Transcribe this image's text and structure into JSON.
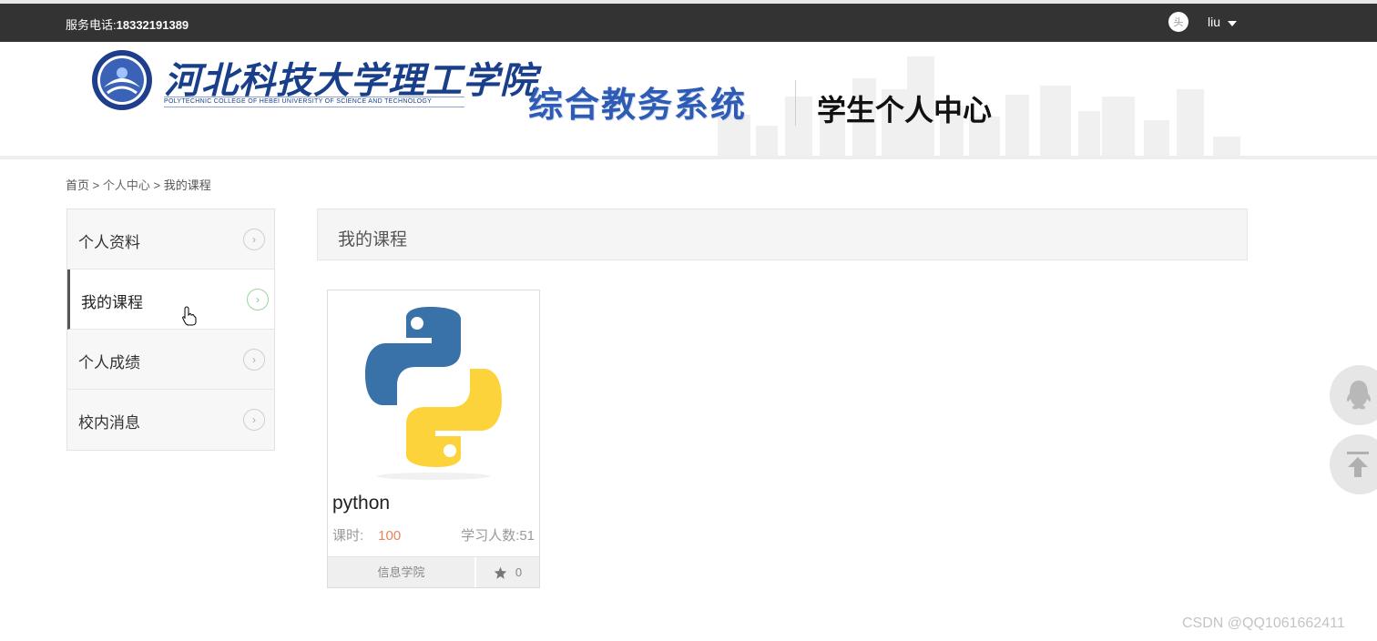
{
  "topbar": {
    "phone_label": "服务电话:",
    "phone_number": "18332191389",
    "avatar_text": "头",
    "username": "liu"
  },
  "header": {
    "school_name": "河北科技大学理工学院",
    "school_name_en": "POLYTECHNIC COLLEGE OF HEBEI UNIVERSITY OF SCIENCE AND TECHNOLOGY",
    "system_name": "综合教务系统",
    "center_title": "学生个人中心"
  },
  "breadcrumb": {
    "home": "首页",
    "sep1": " > ",
    "personal": "个人中心",
    "sep2": " > ",
    "current": "我的课程"
  },
  "sidebar": {
    "items": [
      {
        "label": "个人资料",
        "active": false
      },
      {
        "label": "我的课程",
        "active": true
      },
      {
        "label": "个人成绩",
        "active": false
      },
      {
        "label": "校内消息",
        "active": false
      }
    ]
  },
  "panel": {
    "title": "我的课程"
  },
  "courses": [
    {
      "name": "python",
      "hours_label": "课时:",
      "hours_value": "100",
      "students_label": "学习人数:",
      "students_value": "51",
      "college": "信息学院",
      "favorites": "0",
      "icon": "python-logo"
    }
  ],
  "floating": {
    "qq_icon": "qq-icon",
    "top_icon": "back-to-top-icon"
  },
  "watermark": "CSDN @QQ1061662411",
  "colors": {
    "topbar_bg": "#333333",
    "accent_hours": "#e8835a",
    "active_arrow": "#7cc47a"
  }
}
